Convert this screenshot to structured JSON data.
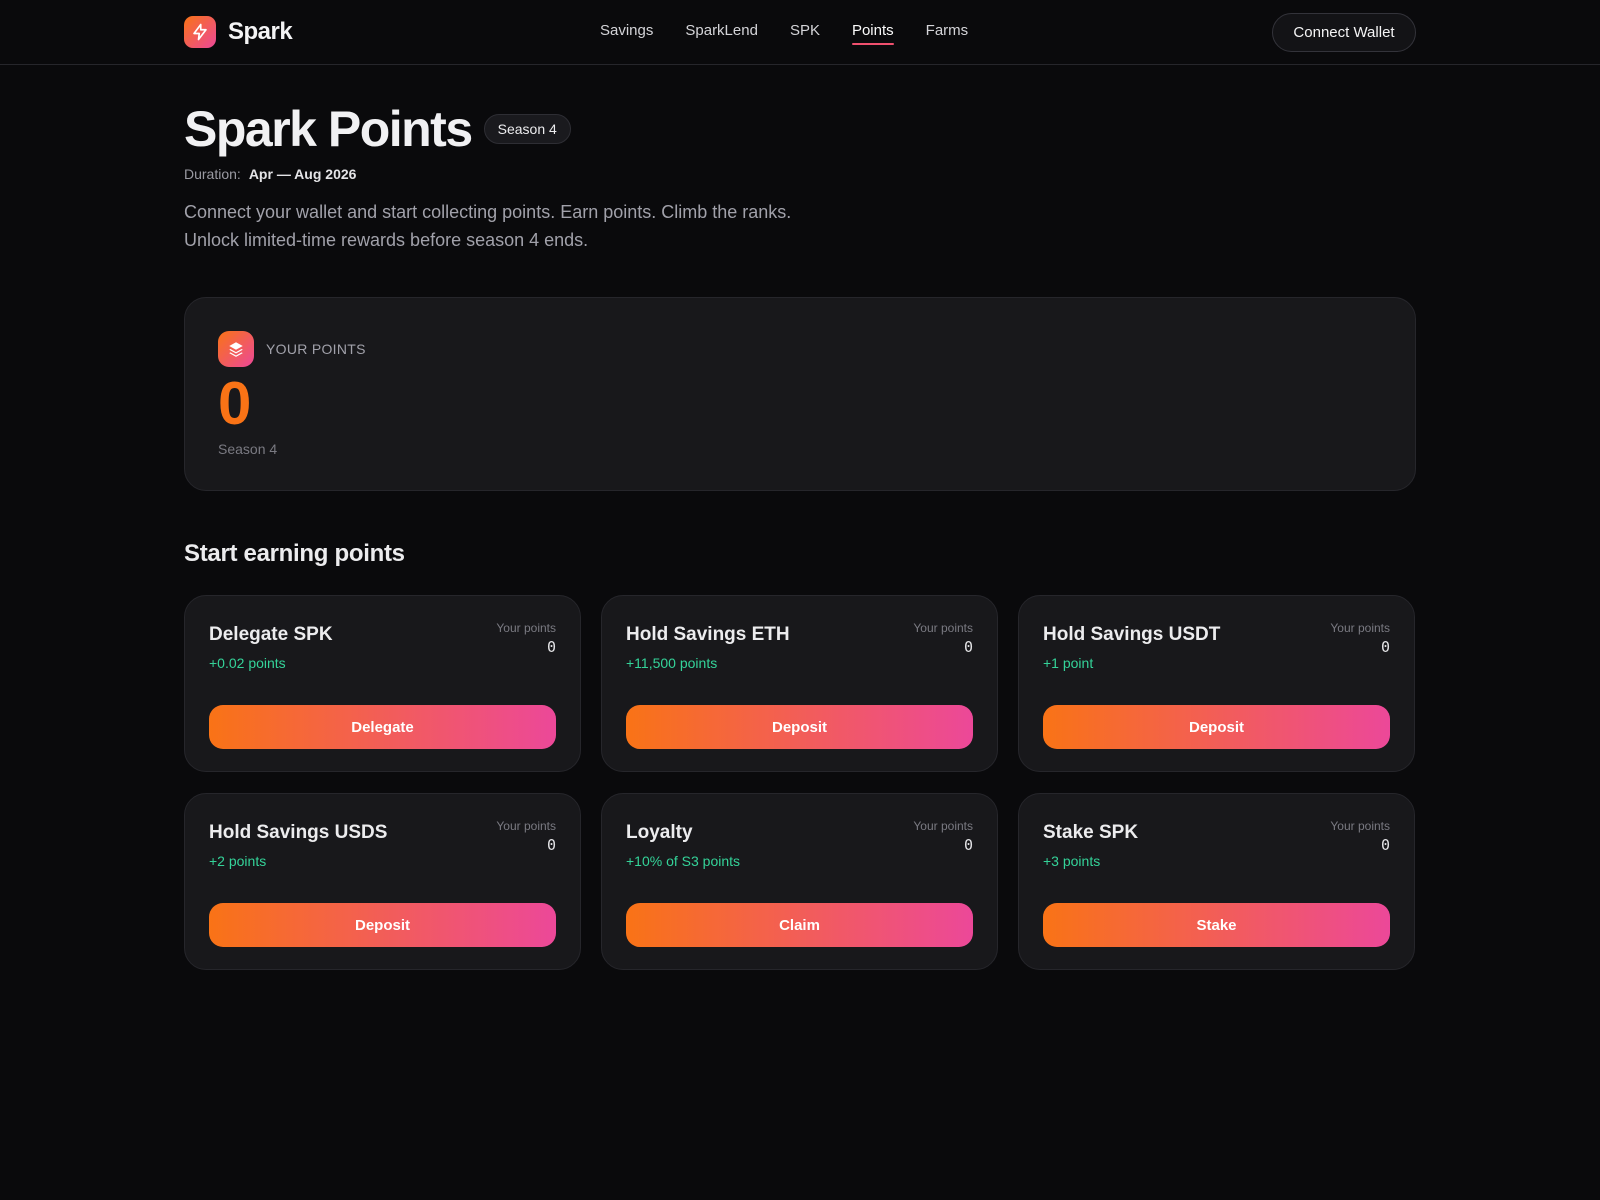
{
  "header": {
    "brand": "Spark",
    "nav": [
      "Savings",
      "SparkLend",
      "SPK",
      "Points",
      "Farms"
    ],
    "active_nav": "Points",
    "connect_label": "Connect Wallet"
  },
  "hero": {
    "title": "Spark Points",
    "season_badge": "Season 4",
    "duration_label": "Duration:",
    "duration_value": "Apr — Aug 2026",
    "intro_line1": "Connect your wallet and start collecting points. Earn points. Climb the ranks.",
    "intro_line2": "Unlock limited-time rewards before season 4 ends."
  },
  "your_points": {
    "label": "YOUR POINTS",
    "value": "0",
    "season": "Season 4"
  },
  "earning": {
    "title": "Start earning points",
    "your_points_label": "Your points",
    "cards": [
      {
        "title": "Delegate SPK",
        "reward": "+0.02 points",
        "your_points": "0",
        "action": "Delegate"
      },
      {
        "title": "Hold Savings ETH",
        "reward": "+11,500 points",
        "your_points": "0",
        "action": "Deposit"
      },
      {
        "title": "Hold Savings USDT",
        "reward": "+1 point",
        "your_points": "0",
        "action": "Deposit"
      },
      {
        "title": "Hold Savings USDS",
        "reward": "+2 points",
        "your_points": "0",
        "action": "Deposit"
      },
      {
        "title": "Loyalty",
        "reward": "+10% of S3 points",
        "your_points": "0",
        "action": "Claim"
      },
      {
        "title": "Stake SPK",
        "reward": "+3 points",
        "your_points": "0",
        "action": "Stake"
      }
    ]
  },
  "colors": {
    "accent_orange": "#f97316",
    "accent_pink": "#ec4899",
    "reward_green": "#34d399",
    "background": "#0a0a0c",
    "card": "#18181b"
  },
  "icons": {
    "brand": "lightning-icon",
    "points": "layers-icon"
  }
}
